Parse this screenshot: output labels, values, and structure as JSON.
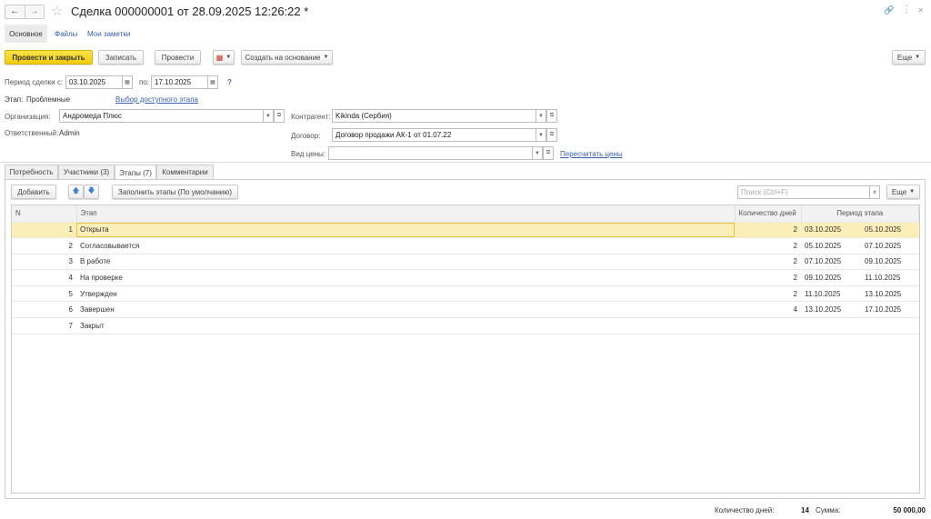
{
  "header": {
    "title": "Сделка 000000001 от 28.09.2025 12:26:22 *"
  },
  "nav_tabs": [
    "Основное",
    "Файлы",
    "Мои заметки"
  ],
  "toolbar": {
    "post_close": "Провести и закрыть",
    "save": "Записать",
    "post": "Провести",
    "create_based": "Создать на основание",
    "more": "Еще"
  },
  "period": {
    "label_from": "Период сделки с:",
    "from": "03.10.2025",
    "label_to": "по:",
    "to": "17.10.2025",
    "help": "?"
  },
  "stage": {
    "label": "Этап:",
    "value": "Проблемные",
    "link": "Выбор доступного этапа"
  },
  "org": {
    "label": "Организация:",
    "value": "Андромеда Плюс"
  },
  "responsible": {
    "label": "Ответственный:",
    "value": "Admin"
  },
  "counterparty": {
    "label": "Контрагент:",
    "value": "Kikinda (Сербия)"
  },
  "contract": {
    "label": "Договор:",
    "value": "Договор продажи АК-1 от 01.07.22"
  },
  "price_type": {
    "label": "Вид цены:",
    "value": "",
    "link": "Пересчитать цены"
  },
  "tabs": [
    "Потребность",
    "Участники (3)",
    "Этапы (7)",
    "Комментарии"
  ],
  "table_toolbar": {
    "add": "Добавить",
    "fill": "Заполнить этапы (По умолчанию)",
    "search_placeholder": "Поиск (Ctrl+F)",
    "more": "Еще"
  },
  "table": {
    "headers": {
      "n": "N",
      "stage": "Этап",
      "days": "Количество дней",
      "period": "Период этапа"
    },
    "rows": [
      {
        "n": "1",
        "stage": "Открыта",
        "days": "2",
        "from": "03.10.2025",
        "to": "05.10.2025"
      },
      {
        "n": "2",
        "stage": "Согласовывается",
        "days": "2",
        "from": "05.10.2025",
        "to": "07.10.2025"
      },
      {
        "n": "3",
        "stage": "В работе",
        "days": "2",
        "from": "07.10.2025",
        "to": "09.10.2025"
      },
      {
        "n": "4",
        "stage": "На проверке",
        "days": "2",
        "from": "09.10.2025",
        "to": "11.10.2025"
      },
      {
        "n": "5",
        "stage": "Утвержден",
        "days": "2",
        "from": "11.10.2025",
        "to": "13.10.2025"
      },
      {
        "n": "6",
        "stage": "Завершен",
        "days": "4",
        "from": "13.10.2025",
        "to": "17.10.2025"
      },
      {
        "n": "7",
        "stage": "Закрыт",
        "days": "",
        "from": "",
        "to": ""
      }
    ]
  },
  "footer": {
    "days_label": "Количество дней:",
    "days": "14",
    "sum_label": "Сумма:",
    "sum": "50 000,00"
  }
}
